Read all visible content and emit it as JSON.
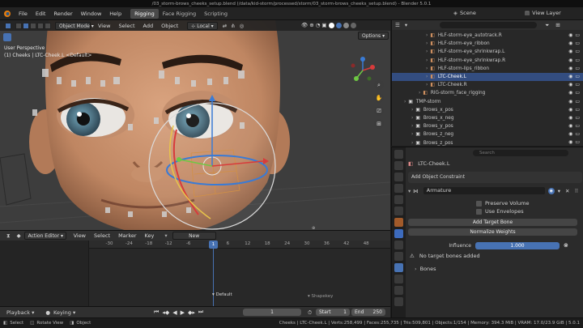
{
  "window": {
    "title": "/03_storm-brows_cheeks_setup.blend (/data/kid-storm/processed/storm/03_storm-brows_cheeks_setup.blend) - Blender 5.0.1"
  },
  "topbar": {
    "menus": [
      "File",
      "Edit",
      "Render",
      "Window",
      "Help"
    ],
    "workspaces": [
      "Rigging",
      "Face Rigging",
      "Scripting"
    ],
    "scene_label": "Scene",
    "view_layer_label": "View Layer"
  },
  "viewport": {
    "mode": "Object Mode",
    "menus": [
      "View",
      "Select",
      "Add",
      "Object"
    ],
    "transform_orientation": "Local",
    "options_label": "Options",
    "perspective_label": "User Perspective",
    "object_label": "(1) Cheeks | LTC-Cheek.L <Default>"
  },
  "outliner": {
    "search_placeholder": "",
    "rows": [
      {
        "label": "HLF-storm-eye_autotrack.R",
        "indent": 4
      },
      {
        "label": "HLF-storm-eye_ribbon",
        "indent": 4
      },
      {
        "label": "HLF-storm-eye_shrinkwrap.L",
        "indent": 4
      },
      {
        "label": "HLF-storm-eye_shrinkwrap.R",
        "indent": 4
      },
      {
        "label": "HLF-storm-lips_ribbon",
        "indent": 4
      },
      {
        "label": "LTC-Cheek.L",
        "indent": 4,
        "selected": true
      },
      {
        "label": "LTC-Cheek.R",
        "indent": 4
      },
      {
        "label": "RIG-storm_face_rigging",
        "indent": 3
      },
      {
        "label": "TMP-storm",
        "indent": 1
      },
      {
        "label": "Brows_x_pos",
        "indent": 2
      },
      {
        "label": "Brows_x_neg",
        "indent": 2
      },
      {
        "label": "Brows_y_pos",
        "indent": 2
      },
      {
        "label": "Brows_z_neg",
        "indent": 2
      },
      {
        "label": "Brows_z_pos",
        "indent": 2
      }
    ]
  },
  "properties": {
    "search_placeholder": "Search",
    "object_name": "LTC-Cheek.L",
    "add_constraint_label": "Add Object Constraint",
    "constraint_name": "Armature",
    "preserve_volume_label": "Preserve Volume",
    "use_envelopes_label": "Use Envelopes",
    "add_target_bone_label": "Add Target Bone",
    "normalize_weights_label": "Normalize Weights",
    "influence_label": "Influence",
    "influence_value": "1.000",
    "influence_fraction": 1.0,
    "warning_text": "No target bones added",
    "bones_label": "Bones"
  },
  "timeline": {
    "editor_label": "Action Editor",
    "menus": [
      "View",
      "Select",
      "Marker",
      "Key"
    ],
    "new_label": "New",
    "ticks": [
      "-30",
      "-24",
      "-18",
      "-12",
      "-6",
      "1",
      "6",
      "12",
      "18",
      "24",
      "30",
      "36",
      "42",
      "48"
    ],
    "current_frame": "1",
    "marker_default": "Default",
    "marker_shapekey": "Shapekey"
  },
  "playback": {
    "playback_label": "Playback",
    "keying_label": "Keying",
    "frame_value": "1",
    "start_label": "Start",
    "start_value": "1",
    "end_label": "End",
    "end_value": "250"
  },
  "statusbar": {
    "select_label": "Select",
    "rotate_label": "Rotate View",
    "object_label": "Object",
    "stats": "Cheeks | LTC-Cheek.L | Verts:258,499 | Faces:255,735 | Tris:509,801 | Objects:1/154 | Memory: 394.3 MiB | VRAM: 17.0/23.9 GiB | 5.0.1"
  }
}
